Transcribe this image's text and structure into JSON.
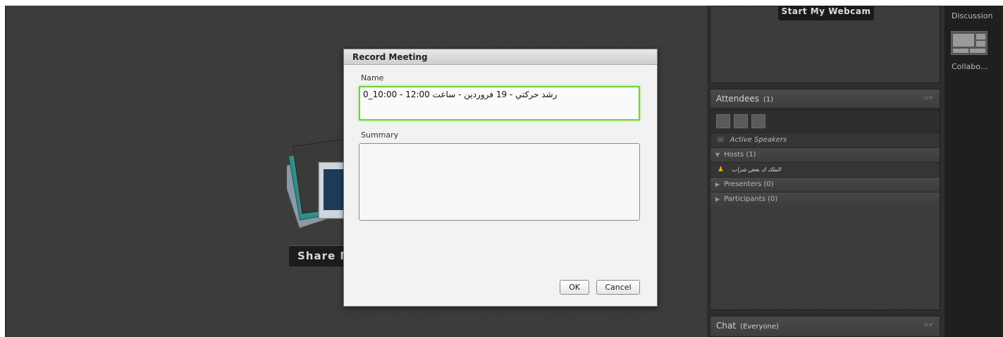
{
  "share_pod": {
    "share_button_label": "Share M"
  },
  "video_pod": {
    "webcam_button_label": "Start My Webcam"
  },
  "attendees": {
    "title": "Attendees",
    "count": "(1)",
    "active_speakers": "Active Speakers",
    "hosts": "Hosts (1)",
    "host_name": "الملك ك بعض شراب",
    "presenters": "Presenters (0)",
    "participants": "Participants (0)"
  },
  "chat": {
    "title": "Chat",
    "scope": "(Everyone)"
  },
  "layouts": {
    "discussion": "Discussion",
    "collaboration": "Collabo..."
  },
  "dialog": {
    "title": "Record Meeting",
    "name_label": "Name",
    "name_value": "رشد حركتي - 19 فروردين - ساعت 12:00 - 10:00_0",
    "summary_label": "Summary",
    "summary_value": "",
    "ok_label": "OK",
    "cancel_label": "Cancel"
  },
  "colors": {
    "focus_border": "#6fd23b",
    "dialog_bg": "#f2f2f2",
    "app_bg": "#2e2e2e"
  },
  "icons": [
    "share-media-icon",
    "phone-icon",
    "host-avatar-icon",
    "list-view-icon",
    "grid-view-icon",
    "user-view-icon",
    "pod-menu-icon",
    "layout-thumbnail-icon"
  ]
}
